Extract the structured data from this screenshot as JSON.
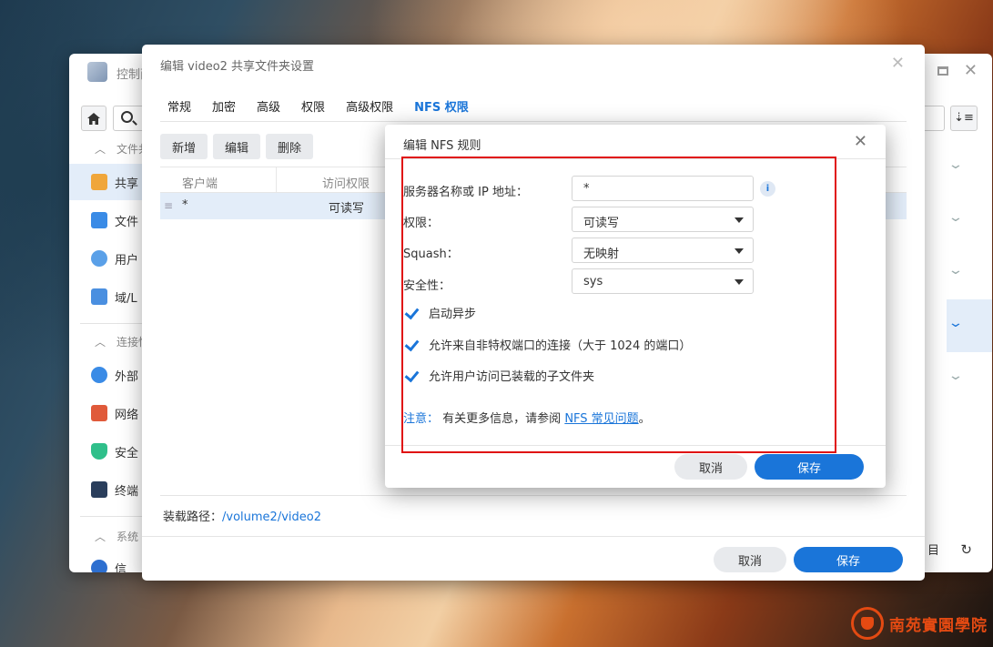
{
  "control_panel": {
    "title": "控制面",
    "sidebar": {
      "sections": [
        {
          "label": "文件共"
        },
        {
          "label": "连接性"
        },
        {
          "label": "系统"
        }
      ],
      "items": [
        {
          "label": "共享"
        },
        {
          "label": "文件"
        },
        {
          "label": "用户"
        },
        {
          "label": "域/L"
        },
        {
          "label": "外部"
        },
        {
          "label": "网络"
        },
        {
          "label": "安全"
        },
        {
          "label": "终端"
        },
        {
          "label": "信"
        }
      ]
    },
    "bottom_text": "目"
  },
  "share_dialog": {
    "title": "编辑 video2 共享文件夹设置",
    "tabs": [
      "常规",
      "加密",
      "高级",
      "权限",
      "高级权限",
      "NFS 权限"
    ],
    "active_tab": "NFS 权限",
    "buttons": {
      "add": "新增",
      "edit": "编辑",
      "delete": "删除"
    },
    "table": {
      "headers": [
        "客户端",
        "访问权限"
      ],
      "rows": [
        {
          "client": "*",
          "access": "可读写"
        }
      ]
    },
    "mount_path_label": "装载路径：",
    "mount_path": "/volume2/video2",
    "cancel": "取消",
    "save": "保存"
  },
  "nfs_rule_dialog": {
    "title": "编辑 NFS 规则",
    "fields": {
      "host_label": "服务器名称或 IP 地址：",
      "host_value": "*",
      "privilege_label": "权限：",
      "privilege_value": "可读写",
      "squash_label": "Squash：",
      "squash_value": "无映射",
      "security_label": "安全性：",
      "security_value": "sys"
    },
    "checkboxes": [
      {
        "label": "启动异步",
        "checked": true
      },
      {
        "label": "允许来自非特权端口的连接（大于 1024 的端口）",
        "checked": true
      },
      {
        "label": "允许用户访问已装载的子文件夹",
        "checked": true
      }
    ],
    "note_label": "注意：",
    "note_text": "有关更多信息，请参阅",
    "note_link": "NFS 常见问题",
    "note_end": "。",
    "cancel": "取消",
    "save": "保存"
  },
  "watermark": {
    "text": "南苑實園學院"
  },
  "colors": {
    "accent": "#1a75d9",
    "highlight": "#e01010"
  }
}
